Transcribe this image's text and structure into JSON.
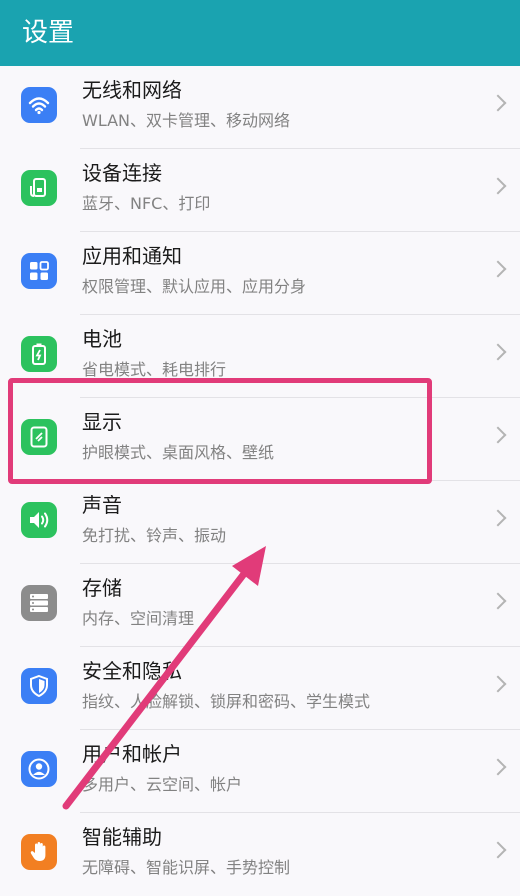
{
  "header": {
    "title": "设置"
  },
  "settings": [
    {
      "title": "无线和网络",
      "subtitle": "WLAN、双卡管理、移动网络",
      "icon": "wifi-icon",
      "color": "#3b7ff5"
    },
    {
      "title": "设备连接",
      "subtitle": "蓝牙、NFC、打印",
      "icon": "device-connect-icon",
      "color": "#2cc25e"
    },
    {
      "title": "应用和通知",
      "subtitle": "权限管理、默认应用、应用分身",
      "icon": "apps-grid-icon",
      "color": "#3b7ff5"
    },
    {
      "title": "电池",
      "subtitle": "省电模式、耗电排行",
      "icon": "battery-icon",
      "color": "#2cc25e"
    },
    {
      "title": "显示",
      "subtitle": "护眼模式、桌面风格、壁纸",
      "icon": "display-icon",
      "color": "#2cc25e"
    },
    {
      "title": "声音",
      "subtitle": "免打扰、铃声、振动",
      "icon": "speaker-icon",
      "color": "#2cc25e"
    },
    {
      "title": "存储",
      "subtitle": "内存、空间清理",
      "icon": "storage-icon",
      "color": "#8c8c8c"
    },
    {
      "title": "安全和隐私",
      "subtitle": "指纹、人脸解锁、锁屏和密码、学生模式",
      "icon": "shield-icon",
      "color": "#3b7ff5"
    },
    {
      "title": "用户和帐户",
      "subtitle": "多用户、云空间、帐户",
      "icon": "user-icon",
      "color": "#3b7ff5"
    },
    {
      "title": "智能辅助",
      "subtitle": "无障碍、智能识屏、手势控制",
      "icon": "hand-icon",
      "color": "#f27f22"
    }
  ],
  "annotation": {
    "color": "#e13b79",
    "highlighted_item": "显示"
  }
}
